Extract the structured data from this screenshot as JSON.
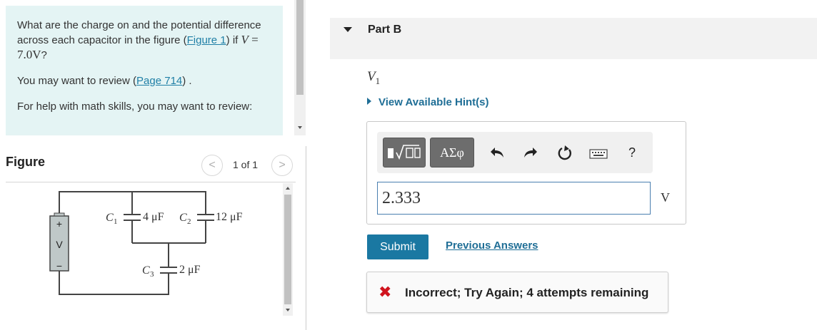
{
  "question": {
    "text_before_link": "What are the charge on and the potential difference across each capacitor in the figure (",
    "figure_link": "Figure 1",
    "text_after_link": ") if ",
    "math_var": "V",
    "math_rest": " = 7.0V",
    "question_mark": "?",
    "review_before": "You may want to review (",
    "review_link": "Page 714",
    "review_after": ") .",
    "help_text": "For help with math skills, you may want to review:"
  },
  "figure": {
    "title": "Figure",
    "counter": "1 of 1",
    "prev_icon": "chevron-left-icon",
    "next_icon": "chevron-right-icon",
    "prev_glyph": "<",
    "next_glyph": ">",
    "labels": {
      "battery_plus": "+",
      "battery_v": "V",
      "battery_minus": "−",
      "c1": "C",
      "c1_sub": "1",
      "c1_value": "4 μF",
      "c2": "C",
      "c2_sub": "2",
      "c2_value": "12 μF",
      "c3": "C",
      "c3_sub": "3",
      "c3_value": "2 μF"
    }
  },
  "part": {
    "title": "Part B",
    "variable": "V",
    "variable_sub": "1",
    "hint_link": "View Available Hint(s)"
  },
  "toolbar": {
    "templates_icon": "templates-sqrt-icon",
    "symbols_label": "ΑΣφ",
    "undo_glyph": "↶",
    "redo_glyph": "↷",
    "reset_glyph": "↻",
    "keyboard_icon": "keyboard-icon",
    "help_label": "?"
  },
  "answer": {
    "value": "2.333",
    "unit": "V"
  },
  "actions": {
    "submit_label": "Submit",
    "previous_answers_label": "Previous Answers"
  },
  "feedback": {
    "icon_glyph": "✖",
    "message": "Incorrect; Try Again; 4 attempts remaining",
    "color": "#d0141e"
  },
  "colors": {
    "accent": "#1a78a2",
    "link": "#1f6e96",
    "question_bg": "#e4f4f4"
  }
}
